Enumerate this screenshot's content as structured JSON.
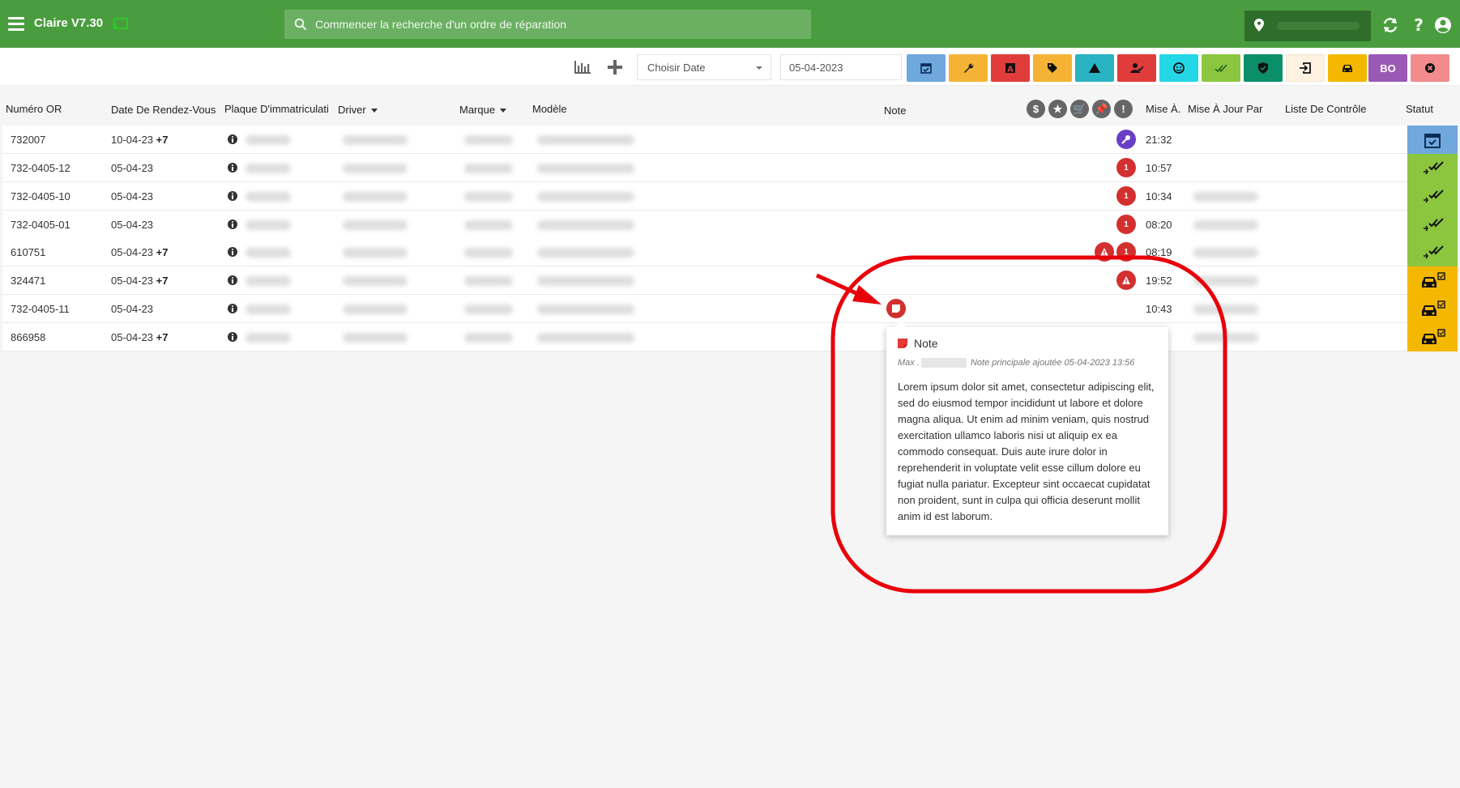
{
  "app": {
    "title": "Claire V7.30"
  },
  "search": {
    "placeholder": "Commencer la recherche d'un ordre de réparation"
  },
  "toolbar": {
    "date_select": "Choisir Date",
    "date_value": "05-04-2023",
    "filter_buttons": [
      {
        "name": "calendar",
        "color": "#6fa8dc"
      },
      {
        "name": "wrench",
        "color": "#f5b335"
      },
      {
        "name": "letter-a",
        "color": "#e03c3c"
      },
      {
        "name": "tag",
        "color": "#f5b335"
      },
      {
        "name": "warning",
        "color": "#2ab3c2"
      },
      {
        "name": "user-check",
        "color": "#e03c3c"
      },
      {
        "name": "face",
        "color": "#24d7e6"
      },
      {
        "name": "double-check",
        "color": "#8cc63f"
      },
      {
        "name": "shield",
        "color": "#0b8f6b"
      },
      {
        "name": "exit",
        "color": "#fdf1e2"
      },
      {
        "name": "car",
        "color": "#f5b800"
      },
      {
        "name": "bo",
        "color": "#9b59b6",
        "label": "BO"
      },
      {
        "name": "cancel",
        "color": "#f28b8b"
      }
    ]
  },
  "table": {
    "headers": {
      "numero": "Numéro OR",
      "date": "Date De Rendez-Vous",
      "plaque": "Plaque D'immatriculati",
      "driver": "Driver",
      "marque": "Marque",
      "modele": "Modèle",
      "note": "Note",
      "mise": "Mise À.",
      "mise_par": "Mise À Jour Par",
      "liste": "Liste De Contrôle",
      "statut": "Statut"
    },
    "header_icons": [
      "$",
      "★",
      "🛒",
      "📌",
      "!"
    ],
    "rows": [
      {
        "numero": "732007",
        "date": "10-04-23",
        "plus": "+7",
        "time": "21:32",
        "status": "calendar"
      },
      {
        "numero": "732-0405-12",
        "date": "05-04-23",
        "plus": "",
        "time": "10:57",
        "status": "check"
      },
      {
        "numero": "732-0405-10",
        "date": "05-04-23",
        "plus": "",
        "time": "10:34",
        "status": "check"
      },
      {
        "numero": "732-0405-01",
        "date": "05-04-23",
        "plus": "",
        "time": "08:20",
        "status": "check"
      },
      {
        "numero": "610751",
        "date": "05-04-23",
        "plus": "+7",
        "time": "08:19",
        "status": "check"
      },
      {
        "numero": "324471",
        "date": "05-04-23",
        "plus": "+7",
        "time": "19:52",
        "status": "car"
      },
      {
        "numero": "732-0405-11",
        "date": "05-04-23",
        "plus": "",
        "time": "10:43",
        "status": "car"
      },
      {
        "numero": "866958",
        "date": "05-04-23",
        "plus": "+7",
        "time": "",
        "status": "car"
      }
    ],
    "badge_one": "1"
  },
  "note_popover": {
    "title": "Note",
    "author": "Max .",
    "meta": "Note principale ajoutée 05-04-2023 13:56",
    "body": "Lorem ipsum dolor sit amet, consectetur adipiscing elit, sed do eiusmod tempor incididunt ut labore et dolore magna aliqua. Ut enim ad minim veniam, quis nostrud exercitation ullamco laboris nisi ut aliquip ex ea commodo consequat. Duis aute irure dolor in reprehenderit in voluptate velit esse cillum dolore eu fugiat nulla pariatur. Excepteur sint occaecat cupidatat non proident, sunt in culpa qui officia deserunt mollit anim id est laborum."
  },
  "colors": {
    "topbar": "#4a9d3f",
    "status_blue": "#6fa8dc",
    "status_green": "#8cc63f",
    "status_yellow": "#f5b800",
    "badge_red": "#d32f2f",
    "badge_purple": "#6a3fc7",
    "annotation_red": "#e8000b"
  }
}
